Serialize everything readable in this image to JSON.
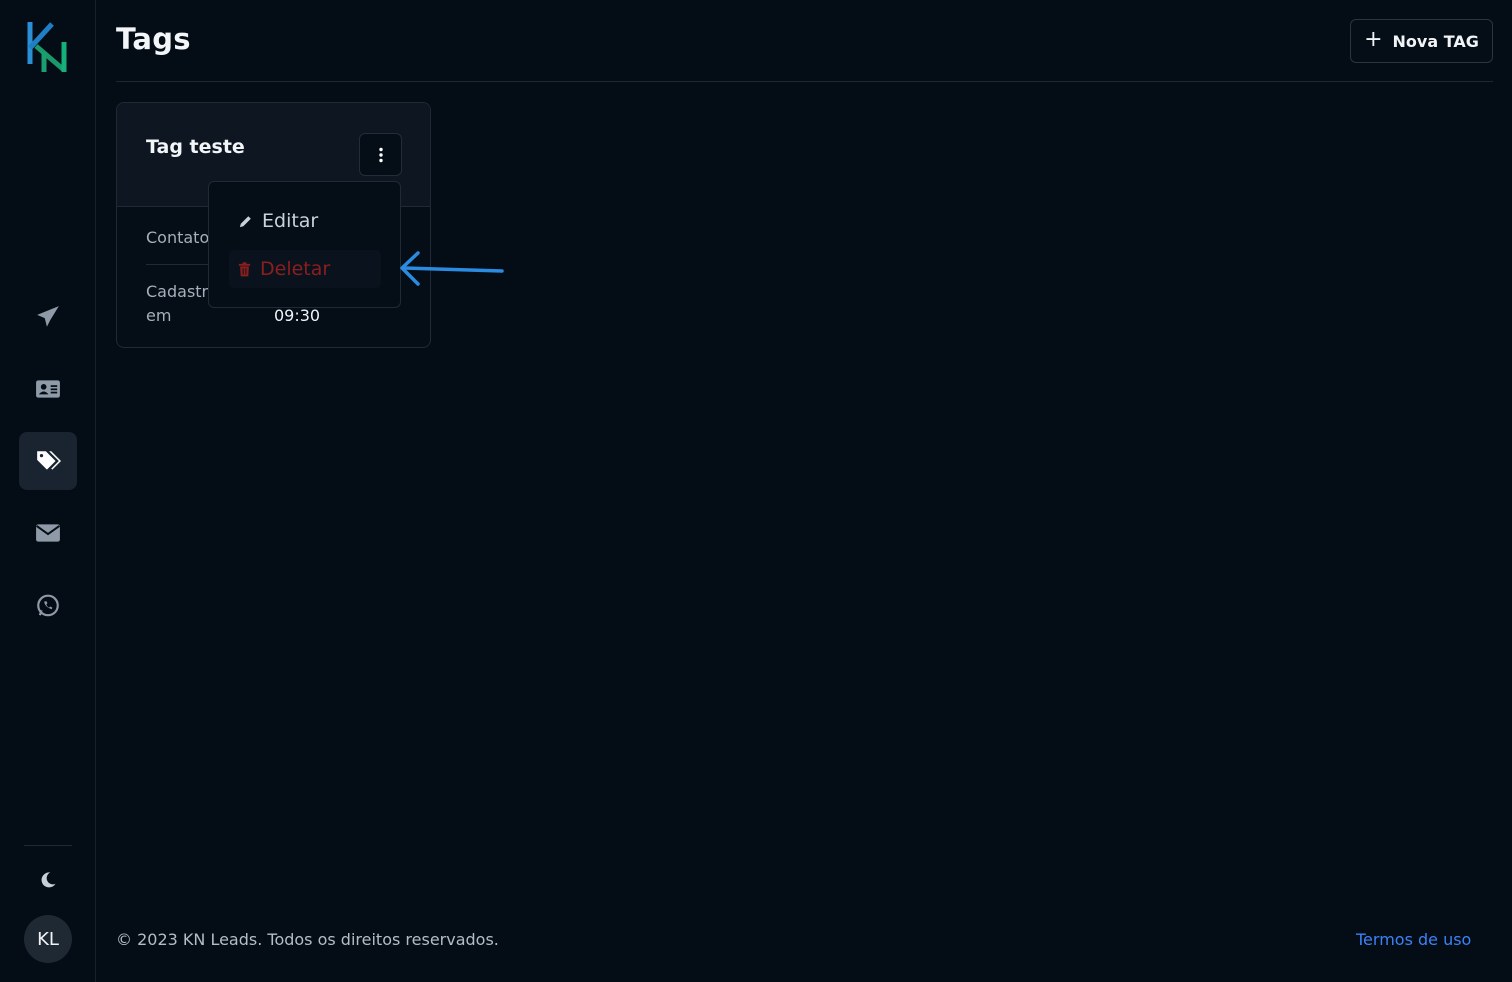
{
  "app": {
    "logo": "KN"
  },
  "sidebar": {
    "items": [
      {
        "name": "campaigns",
        "icon": "paper-plane-icon"
      },
      {
        "name": "contacts",
        "icon": "address-card-icon"
      },
      {
        "name": "tags",
        "icon": "tags-icon",
        "active": true
      },
      {
        "name": "email",
        "icon": "envelope-icon"
      },
      {
        "name": "whatsapp",
        "icon": "whatsapp-icon"
      }
    ],
    "theme_icon": "moon-icon",
    "avatar_initials": "KL"
  },
  "header": {
    "title": "Tags",
    "new_button_icon": "+",
    "new_button_label": "Nova TAG"
  },
  "card": {
    "title": "Tag teste",
    "contacts_label": "Contatos",
    "created_label": "Cadastrada",
    "created_label_line2": "em",
    "created_time": "09:30"
  },
  "menu": {
    "edit_label": "Editar",
    "delete_label": "Deletar"
  },
  "footer": {
    "copyright": "© 2023 KN Leads. Todos os direitos reservados.",
    "terms_link": "Termos de uso"
  },
  "colors": {
    "background": "#040c16",
    "accent_link": "#3b82f6",
    "danger": "#8b1e1e",
    "annotation_arrow": "#2b8be0"
  }
}
